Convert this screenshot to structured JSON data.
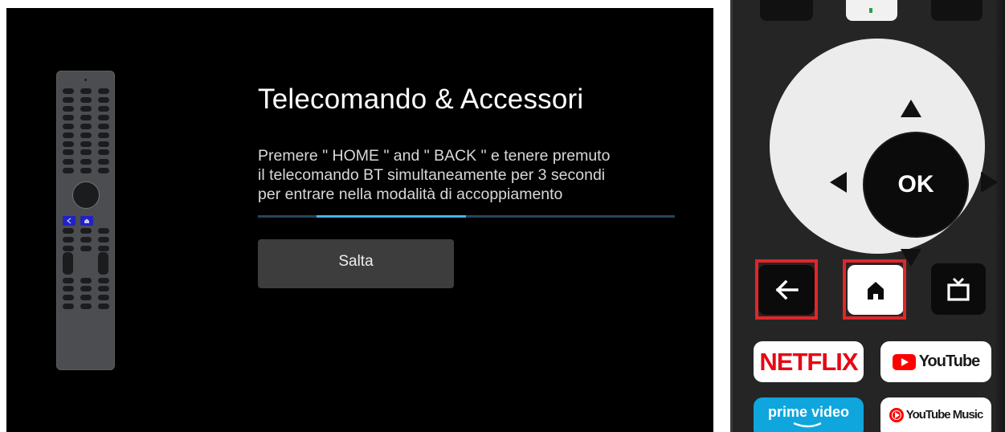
{
  "screen": {
    "title": "Telecomando & Accessori",
    "description_lines": [
      "Premere \" HOME \" and \" BACK \" e tenere premuto",
      "il telecomando BT simultaneamente per 3 secondi",
      "per entrare nella modalità di accoppiamento"
    ],
    "progress": {
      "segment_start": 0.14,
      "segment_end": 0.5
    },
    "skip_button": {
      "label": "Salta"
    },
    "mini_remote_highlighted_keys": [
      "back-icon",
      "home-icon"
    ]
  },
  "remote": {
    "dpad": {
      "ok_label": "OK"
    },
    "keys": {
      "back_icon": "back-arrow-icon",
      "home_icon": "home-icon",
      "tv_icon": "tv-icon"
    },
    "highlighted_keys": [
      "back",
      "home"
    ],
    "app_buttons": {
      "netflix": "NETFLIX",
      "youtube": "YouTube",
      "prime_video": "prime video",
      "youtube_music": "YouTube Music"
    }
  },
  "colors": {
    "screen_bg": "#000000",
    "accent_progress": "#47b3ea",
    "highlight_frame": "#e0262a",
    "netflix_red": "#e50914",
    "youtube_red": "#ff0000",
    "prime_blue": "#0fa5dd"
  }
}
